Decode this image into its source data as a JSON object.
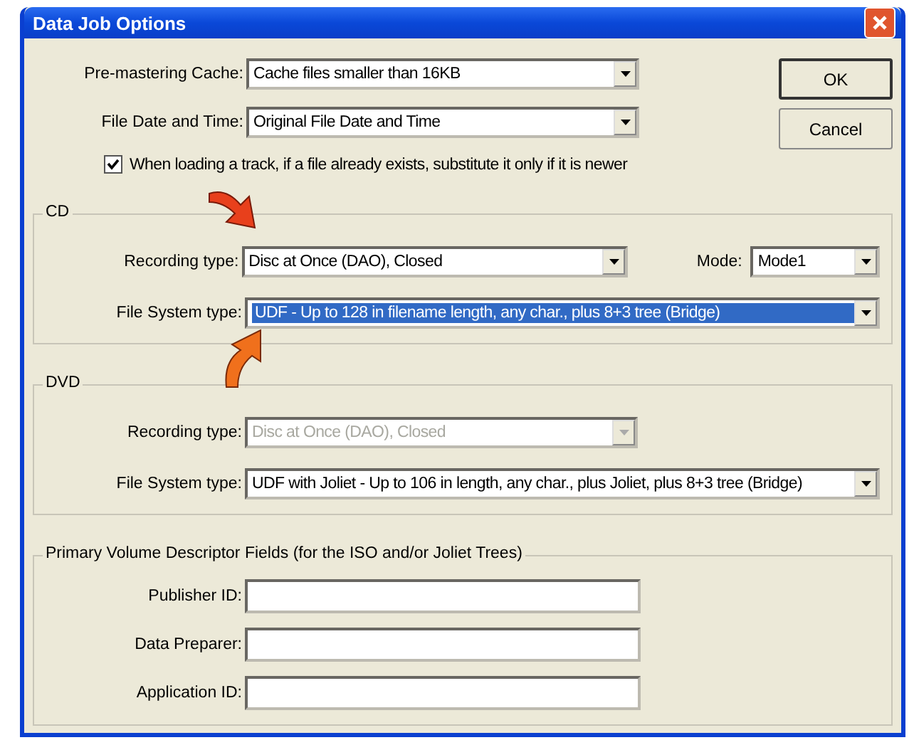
{
  "window": {
    "title": "Data Job Options"
  },
  "general": [
    {
      "label": "Pre-mastering Cache:",
      "value": "Cache files smaller than 16KB"
    },
    {
      "label": "File Date and Time:",
      "value": "Original File Date and Time"
    }
  ],
  "checkbox": {
    "label": "When loading a track, if a file already exists, substitute it only if it is newer",
    "checked": true
  },
  "buttons": [
    {
      "label": "OK",
      "default": true
    },
    {
      "label": "Cancel",
      "default": false
    }
  ],
  "groups": [
    {
      "title": "CD",
      "fields": [
        {
          "label": "Recording type:",
          "value": "Disc at Once (DAO), Closed",
          "kind": "short",
          "disabled": false,
          "highlighted": false
        },
        {
          "label": "File System type:",
          "value": "UDF - Up to 128 in filename length, any char., plus 8+3 tree (Bridge)",
          "kind": "wide",
          "disabled": false,
          "highlighted": true
        }
      ],
      "mode": {
        "label": "Mode:",
        "value": "Mode1"
      }
    },
    {
      "title": "DVD",
      "fields": [
        {
          "label": "Recording type:",
          "value": "Disc at Once (DAO), Closed",
          "kind": "short",
          "disabled": true,
          "highlighted": false
        },
        {
          "label": "File System type:",
          "value": "UDF with Joliet - Up to 106 in length, any char., plus Joliet, plus 8+3 tree (Bridge)",
          "kind": "wide",
          "disabled": false,
          "highlighted": false
        }
      ]
    }
  ],
  "pvd": {
    "title": "Primary Volume Descriptor Fields (for the ISO and/or Joliet Trees)",
    "fields": [
      {
        "label": "Publisher ID:"
      },
      {
        "label": "Data Preparer:"
      },
      {
        "label": "Application ID:"
      }
    ]
  }
}
